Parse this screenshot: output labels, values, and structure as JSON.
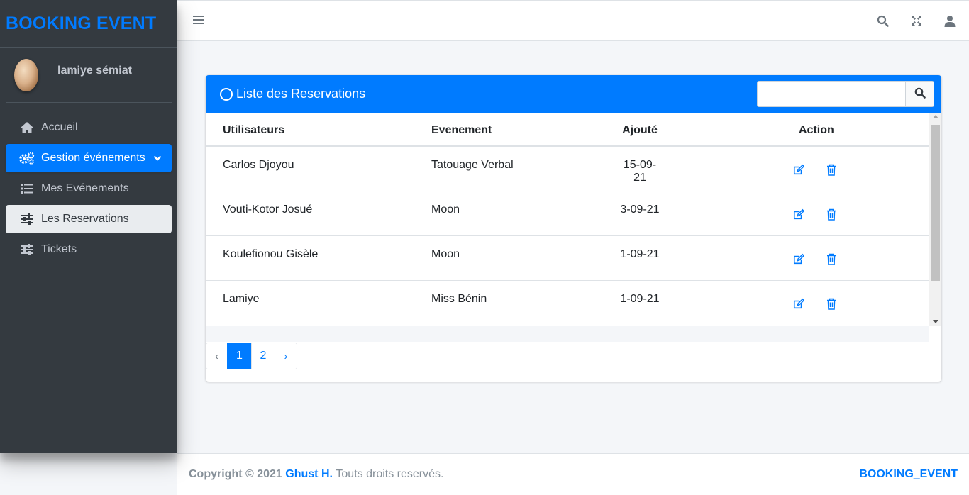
{
  "brand": {
    "title": "BOOKING EVENT"
  },
  "user": {
    "name": "lamiye sémiat"
  },
  "sidebar": {
    "items": [
      {
        "label": "Accueil",
        "icon": "home-icon"
      },
      {
        "label": "Gestion événements",
        "icon": "cogs-icon"
      },
      {
        "label": "Mes Evénements",
        "icon": "list-icon"
      },
      {
        "label": "Les Reservations",
        "icon": "sliders-icon"
      },
      {
        "label": "Tickets",
        "icon": "sliders-icon"
      }
    ]
  },
  "topbar": {
    "icons": [
      "menu-icon",
      "search-icon",
      "expand-icon",
      "user-icon"
    ]
  },
  "card": {
    "title": "Liste des Reservations",
    "search": {
      "placeholder": "",
      "value": ""
    }
  },
  "table": {
    "headers": [
      "Utilisateurs",
      "Evenement",
      "Ajouté",
      "Action"
    ],
    "rows": [
      {
        "user": "Carlos Djoyou",
        "event": "Tatouage Verbal",
        "added": "15-09-21"
      },
      {
        "user": "Vouti-Kotor Josué",
        "event": "Moon",
        "added": "3-09-21"
      },
      {
        "user": "Koulefionou Gisèle",
        "event": "Moon",
        "added": "1-09-21"
      },
      {
        "user": "Lamiye",
        "event": "Miss Bénin",
        "added": "1-09-21"
      }
    ]
  },
  "pagination": {
    "prev": "‹",
    "pages": [
      "1",
      "2"
    ],
    "next": "›",
    "current": "1"
  },
  "footer": {
    "copyright": "Copyright © 2021",
    "author": "Ghust H.",
    "rights": "Touts droits reservés.",
    "brand": "BOOKING_EVENT"
  },
  "colors": {
    "primary": "#007bff",
    "sidebar_bg": "#343a40",
    "sidebar_text": "#c2c7d0"
  }
}
